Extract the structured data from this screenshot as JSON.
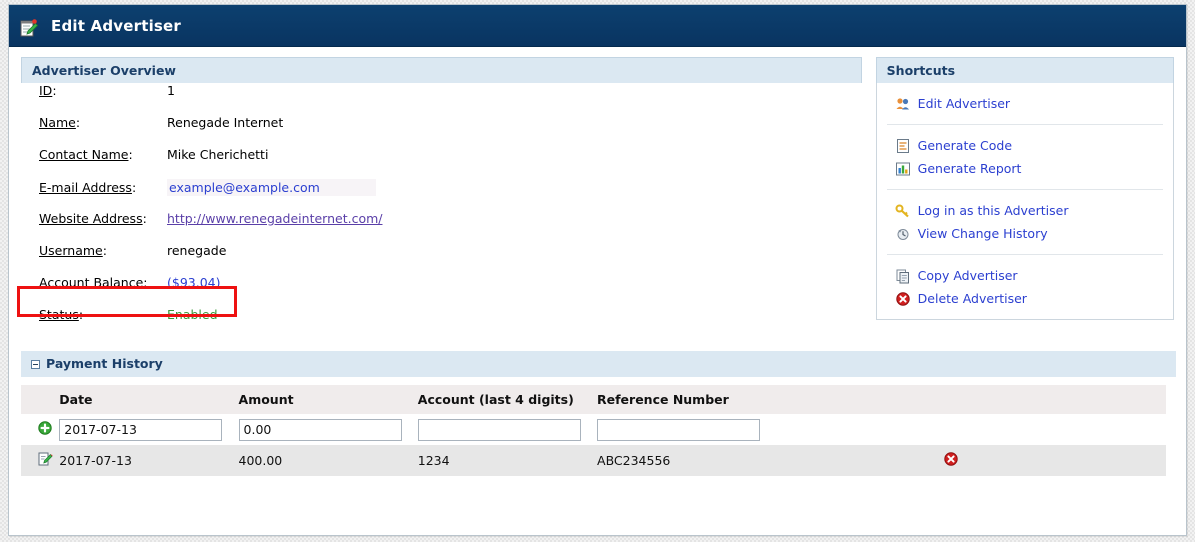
{
  "window": {
    "title": "Edit Advertiser",
    "title_icon": "notepad-pencil-icon"
  },
  "overview": {
    "panel_title": "Advertiser Overview",
    "fields": [
      {
        "label": "ID",
        "value": "1",
        "kind": "text"
      },
      {
        "label": "Name",
        "value": "Renegade Internet",
        "kind": "text"
      },
      {
        "label": "Contact Name",
        "value": "Mike Cherichetti",
        "kind": "text"
      },
      {
        "label": "E-mail Address",
        "value": "example@example.com",
        "kind": "link-blue"
      },
      {
        "label": "Website Address",
        "value": "http://www.renegadeinternet.com/",
        "kind": "link-violet"
      },
      {
        "label": "Username",
        "value": "renegade",
        "kind": "text"
      },
      {
        "label": "Account Balance",
        "value": "($93.04)",
        "kind": "money"
      },
      {
        "label": "Status",
        "value": "Enabled",
        "kind": "status-on"
      }
    ]
  },
  "shortcuts": {
    "panel_title": "Shortcuts",
    "groups": [
      {
        "items": [
          {
            "label": "Edit Advertiser",
            "icon": "users-icon"
          }
        ]
      },
      {
        "items": [
          {
            "label": "Generate Code",
            "icon": "code-document-icon"
          },
          {
            "label": "Generate Report",
            "icon": "bar-chart-icon"
          }
        ]
      },
      {
        "items": [
          {
            "label": "Log in as this Advertiser",
            "icon": "key-icon"
          },
          {
            "label": "View Change History",
            "icon": "history-icon"
          }
        ]
      },
      {
        "items": [
          {
            "label": "Copy Advertiser",
            "icon": "copy-icon"
          },
          {
            "label": "Delete Advertiser",
            "icon": "delete-circle-icon"
          }
        ]
      }
    ]
  },
  "payment_history": {
    "panel_title": "Payment History",
    "collapse_state": "expanded",
    "columns": [
      "Date",
      "Amount",
      "Account (last 4 digits)",
      "Reference Number"
    ],
    "new_row": {
      "add_icon": "add-green-icon",
      "date": "2017-07-13",
      "amount": "0.00",
      "account": "",
      "reference": ""
    },
    "rows": [
      {
        "edit_icon": "edit-icon",
        "date": "2017-07-13",
        "amount": "400.00",
        "account": "1234",
        "reference": "ABC234556",
        "delete_icon": "delete-circle-icon"
      }
    ]
  },
  "annotation": {
    "target": "Account Balance",
    "color": "#ee1111"
  },
  "colors": {
    "titlebar": "#0b3c6e",
    "panel_header": "#dbe8f2",
    "link": "#2b3fd0",
    "link_visited": "#5a3fa8",
    "status_enabled": "#3a9a3a",
    "annotation": "#ee1111",
    "table_header": "#f0ecec",
    "row_alt": "#e7e7e7"
  }
}
